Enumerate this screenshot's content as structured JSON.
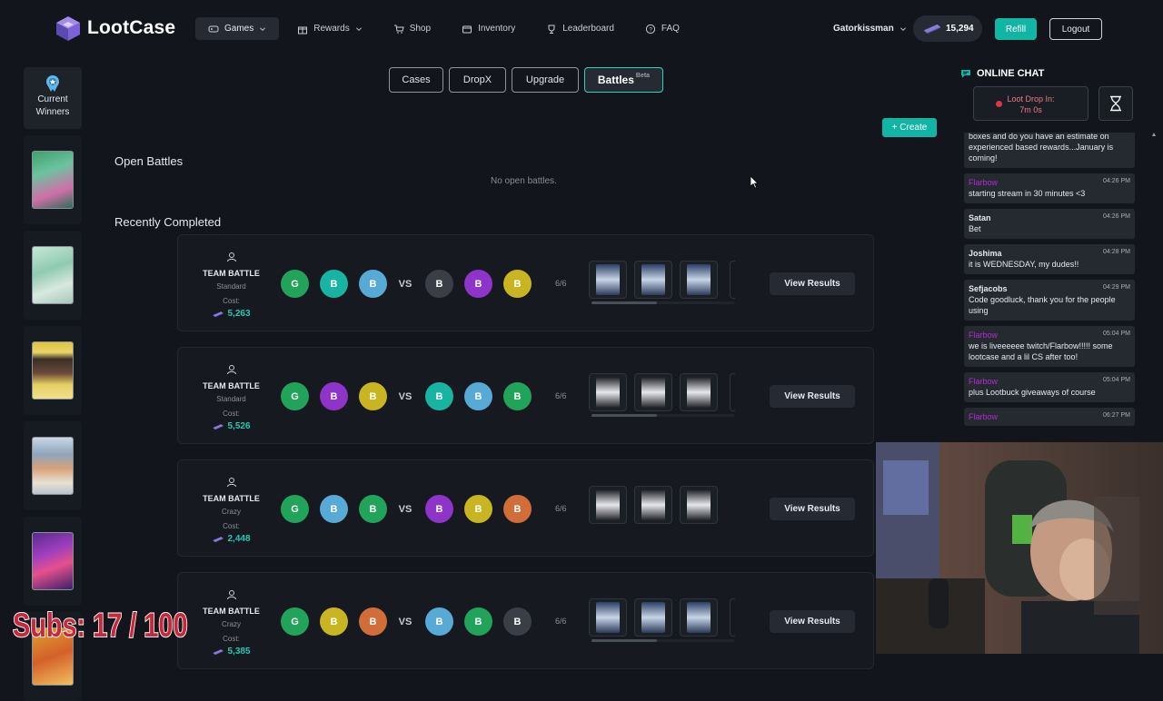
{
  "brand": {
    "name": "LootCase"
  },
  "nav": [
    {
      "label": "Games",
      "icon": "gamepad-icon",
      "active": true
    },
    {
      "label": "Rewards",
      "icon": "gift-icon"
    },
    {
      "label": "Shop",
      "icon": "cart-icon"
    },
    {
      "label": "Inventory",
      "icon": "box-icon"
    },
    {
      "label": "Leaderboard",
      "icon": "trophy-icon"
    },
    {
      "label": "FAQ",
      "icon": "help-icon"
    }
  ],
  "user": {
    "name": "Gatorkissman",
    "balance": "15,294",
    "refill_label": "Refill",
    "logout_label": "Logout"
  },
  "sidebar": {
    "winners_label_1": "Current",
    "winners_label_2": "Winners"
  },
  "tabs": {
    "cases": "Cases",
    "dropx": "DropX",
    "upgrade": "Upgrade",
    "battles": "Battles",
    "battles_badge": "Beta"
  },
  "create_label": "+ Create",
  "open_battles": {
    "title": "Open Battles",
    "empty": "No open battles."
  },
  "recent_title": "Recently Completed",
  "battles": [
    {
      "type": "TEAM BATTLE",
      "mode": "Standard",
      "cost_label": "Cost:",
      "cost": "5,263",
      "rounds": "6/6",
      "view_label": "View Results",
      "team_a": [
        {
          "l": "G",
          "c": "#22a35a"
        },
        {
          "l": "B",
          "c": "#19b3a3"
        },
        {
          "l": "B",
          "c": "#58aad6"
        }
      ],
      "team_b": [
        {
          "l": "B",
          "c": "#3a3f47"
        },
        {
          "l": "B",
          "c": "#8f34c9"
        },
        {
          "l": "B",
          "c": "#c9b522"
        }
      ]
    },
    {
      "type": "TEAM BATTLE",
      "mode": "Standard",
      "cost_label": "Cost:",
      "cost": "5,526",
      "rounds": "6/6",
      "view_label": "View Results",
      "team_a": [
        {
          "l": "G",
          "c": "#22a35a"
        },
        {
          "l": "B",
          "c": "#8f34c9"
        },
        {
          "l": "B",
          "c": "#c9b522"
        }
      ],
      "team_b": [
        {
          "l": "B",
          "c": "#19b3a3"
        },
        {
          "l": "B",
          "c": "#58aad6"
        },
        {
          "l": "B",
          "c": "#22a35a"
        }
      ]
    },
    {
      "type": "TEAM BATTLE",
      "mode": "Crazy",
      "cost_label": "Cost:",
      "cost": "2,448",
      "rounds": "6/6",
      "view_label": "View Results",
      "team_a": [
        {
          "l": "G",
          "c": "#22a35a"
        },
        {
          "l": "B",
          "c": "#58aad6"
        },
        {
          "l": "B",
          "c": "#22a35a"
        }
      ],
      "team_b": [
        {
          "l": "B",
          "c": "#8f34c9"
        },
        {
          "l": "B",
          "c": "#c9b522"
        },
        {
          "l": "B",
          "c": "#d06d38"
        }
      ]
    },
    {
      "type": "TEAM BATTLE",
      "mode": "Crazy",
      "cost_label": "Cost:",
      "cost": "5,385",
      "rounds": "6/6",
      "view_label": "View Results",
      "team_a": [
        {
          "l": "G",
          "c": "#22a35a"
        },
        {
          "l": "B",
          "c": "#c9b522"
        },
        {
          "l": "B",
          "c": "#d06d38"
        }
      ],
      "team_b": [
        {
          "l": "B",
          "c": "#58aad6"
        },
        {
          "l": "B",
          "c": "#22a35a"
        },
        {
          "l": "B",
          "c": "#3a3f47"
        }
      ]
    }
  ],
  "chat": {
    "title": "ONLINE CHAT",
    "lootdrop_label": "Loot Drop In:",
    "lootdrop_time": "7m 0s",
    "messages": [
      {
        "name": "",
        "time": "",
        "text": "boxes and do you have an estimate on experienced based rewards...January is coming!"
      },
      {
        "name": "Flarbow",
        "purple": true,
        "time": "04:26 PM",
        "text": "starting stream in 30 minutes <3"
      },
      {
        "name": "Satan",
        "time": "04:26 PM",
        "text": "Bet"
      },
      {
        "name": "Joshima",
        "time": "04:28 PM",
        "text": "it is WEDNESDAY, my dudes!!"
      },
      {
        "name": "Sefjacobs",
        "time": "04:29 PM",
        "text": "Code goodluck, thank you for the people using"
      },
      {
        "name": "Flarbow",
        "purple": true,
        "time": "05:04 PM",
        "text": "we is liveeeeee twitch/Flarbow!!!!! some lootcase and a lil CS after too!"
      },
      {
        "name": "Flarbow",
        "purple": true,
        "time": "05:04 PM",
        "text": "plus Lootbuck giveaways of course"
      },
      {
        "name": "Flarbow",
        "purple": true,
        "time": "06:27 PM",
        "text": ""
      }
    ]
  },
  "overlay": {
    "subs": "Subs:  17 / 100"
  },
  "colors": {
    "accent": "#12b5a4",
    "background": "#12161c",
    "panel": "#161a20"
  }
}
